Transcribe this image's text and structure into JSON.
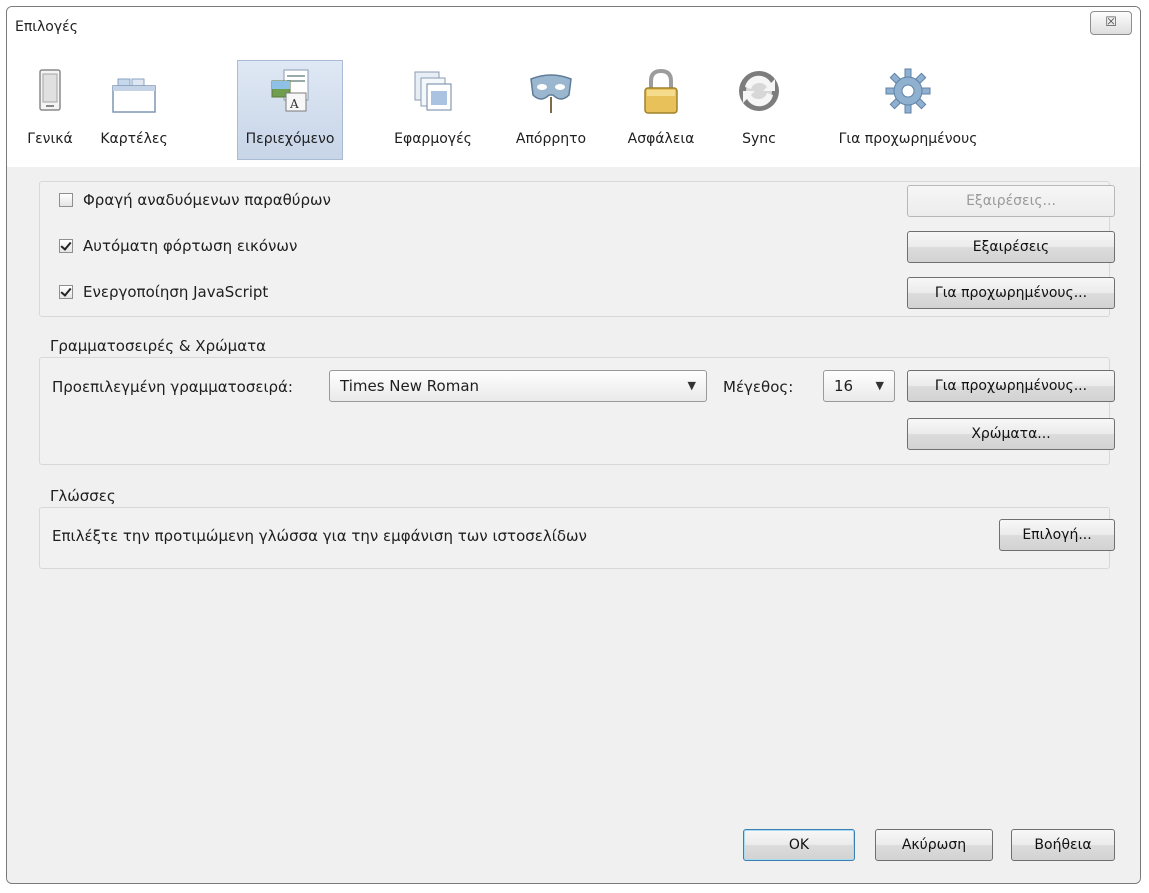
{
  "window": {
    "title": "Επιλογές",
    "close_glyph": "☒"
  },
  "tabs": [
    {
      "label": "Γενικά",
      "icon": "general-icon"
    },
    {
      "label": "Καρτέλες",
      "icon": "tabs-icon"
    },
    {
      "label": "Περιεχόμενο",
      "icon": "content-icon",
      "selected": true
    },
    {
      "label": "Εφαρμογές",
      "icon": "applications-icon"
    },
    {
      "label": "Απόρρητο",
      "icon": "privacy-mask-icon"
    },
    {
      "label": "Ασφάλεια",
      "icon": "lock-icon"
    },
    {
      "label": "Sync",
      "icon": "sync-icon"
    },
    {
      "label": "Για προχωρημένους",
      "icon": "gear-icon"
    }
  ],
  "content": {
    "block_popups_label": "Φραγή αναδυόμενων παραθύρων",
    "block_popups_checked": false,
    "block_popups_exceptions": "Εξαιρέσεις...",
    "load_images_label": "Αυτόματη φόρτωση εικόνων",
    "load_images_checked": true,
    "load_images_exceptions": "Εξαιρέσεις",
    "javascript_label": "Ενεργοποίηση JavaScript",
    "javascript_checked": true,
    "javascript_advanced": "Για προχωρημένους..."
  },
  "fonts": {
    "legend": "Γραμματοσειρές & Χρώματα",
    "default_font_label": "Προεπιλεγμένη γραμματοσειρά:",
    "default_font_value": "Times New Roman",
    "size_label": "Μέγεθος:",
    "size_value": "16",
    "advanced_button": "Για προχωρημένους...",
    "colors_button": "Χρώματα..."
  },
  "languages": {
    "legend": "Γλώσσες",
    "description": "Επιλέξτε την προτιμώμενη γλώσσα για την εμφάνιση των ιστοσελίδων",
    "choose_button": "Επιλογή..."
  },
  "footer": {
    "ok": "OK",
    "cancel": "Ακύρωση",
    "help": "Βοήθεια"
  },
  "colors": {
    "selected_tab_bg": "#c7d5e8",
    "window_bg": "#f0f0f0",
    "ok_focus": "#3c7fb1"
  }
}
